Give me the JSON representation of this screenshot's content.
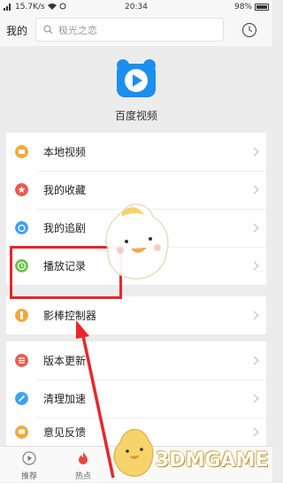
{
  "status_bar": {
    "network": "15.7K/s",
    "time": "20:34",
    "battery": "98%"
  },
  "header": {
    "title": "我的",
    "search_placeholder": "极光之恋"
  },
  "app": {
    "name": "百度视频"
  },
  "menu_group_1": [
    {
      "label": "本地视频",
      "icon": "folder-icon",
      "color": "#f4a93a"
    },
    {
      "label": "我的收藏",
      "icon": "star-icon",
      "color": "#ea5b4e"
    },
    {
      "label": "我的追剧",
      "icon": "alarm-icon",
      "color": "#3fa1f2"
    },
    {
      "label": "播放记录",
      "icon": "clock-icon",
      "color": "#6cc24a"
    }
  ],
  "menu_group_2": [
    {
      "label": "影棒控制器",
      "icon": "stick-icon",
      "color": "#f2a63a"
    }
  ],
  "menu_group_3": [
    {
      "label": "版本更新",
      "icon": "update-icon",
      "color": "#ea5b4e"
    },
    {
      "label": "清理加速",
      "icon": "clean-icon",
      "color": "#3fa1f2"
    },
    {
      "label": "意见反馈",
      "icon": "feedback-icon",
      "color": "#f4a93a"
    }
  ],
  "bottom_nav": [
    {
      "label": "推荐",
      "icon": "play-circle-icon"
    },
    {
      "label": "热点",
      "icon": "fire-icon"
    },
    {
      "label": "",
      "icon": "mascot-icon"
    }
  ],
  "watermark": "3DMGAME",
  "colors": {
    "highlight": "#e8262a",
    "brand": "#1b8ff0"
  }
}
